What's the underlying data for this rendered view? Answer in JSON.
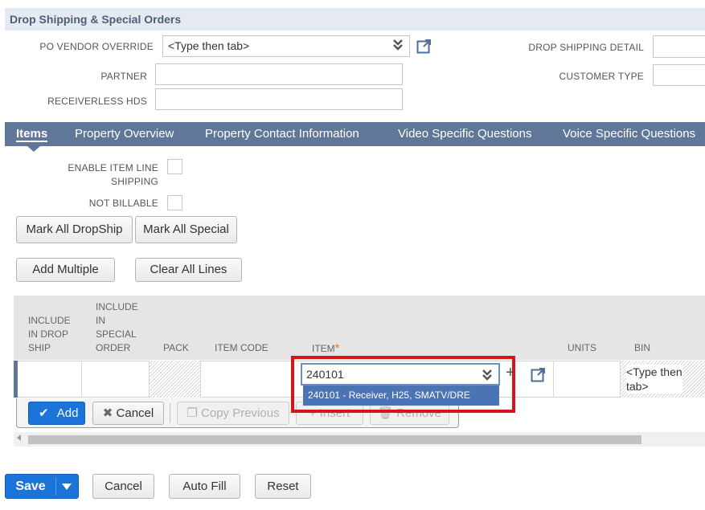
{
  "section": {
    "title": "Drop Shipping & Special Orders"
  },
  "fields": {
    "po_vendor_override_label": "PO VENDOR OVERRIDE",
    "po_vendor_override_value": "<Type then tab>",
    "partner_label": "PARTNER",
    "receiverless_label": "RECEIVERLESS HDS",
    "drop_shipping_detail_label": "DROP SHIPPING DETAIL",
    "customer_type_label": "CUSTOMER TYPE"
  },
  "tabs": [
    {
      "label": "Items",
      "active": true
    },
    {
      "label": "Property Overview"
    },
    {
      "label": "Property Contact Information"
    },
    {
      "label": "Video Specific Questions"
    },
    {
      "label": "Voice Specific Questions"
    }
  ],
  "items_tab": {
    "enable_item_line_shipping_label_1": "ENABLE ITEM LINE",
    "enable_item_line_shipping_label_2": "SHIPPING",
    "not_billable_label": "NOT BILLABLE",
    "mark_all_dropship": "Mark All DropShip",
    "mark_all_special": "Mark All Special",
    "add_multiple": "Add Multiple",
    "clear_all_lines": "Clear All Lines"
  },
  "sublist": {
    "columns": {
      "include_drop_ship": [
        "INCLUDE",
        "IN DROP",
        "SHIP"
      ],
      "include_special_order": [
        "INCLUDE",
        "IN",
        "SPECIAL",
        "ORDER"
      ],
      "pack": "PACK",
      "item_code": "ITEM CODE",
      "item": "ITEM",
      "required_marker": "*",
      "units": "UNITS",
      "bin": "BIN"
    },
    "row": {
      "item_value": "240101",
      "dropdown_option": "240101 - Receiver, H25, SMATV/DRE",
      "bin_value_line1": "<Type then",
      "bin_value_line2": "tab>",
      "plus_symbol": "+"
    },
    "actions": {
      "add": "Add",
      "cancel": "Cancel",
      "copy_previous": "Copy Previous",
      "insert": "Insert",
      "remove": "Remove"
    }
  },
  "footer": {
    "save": "Save",
    "cancel": "Cancel",
    "auto_fill": "Auto Fill",
    "reset": "Reset"
  },
  "colors": {
    "tab_bar": "#607799",
    "section_header_bg": "#e5eaf2",
    "primary_button": "#1b74d9",
    "highlight": "#d6151b",
    "dropdown_selected": "#4a74b4"
  },
  "icons": [
    "double-chevron-down-icon",
    "open-external-icon",
    "check-icon",
    "x-icon",
    "copy-icon",
    "plus-icon",
    "trash-icon",
    "caret-down-icon",
    "scroll-left-icon"
  ]
}
